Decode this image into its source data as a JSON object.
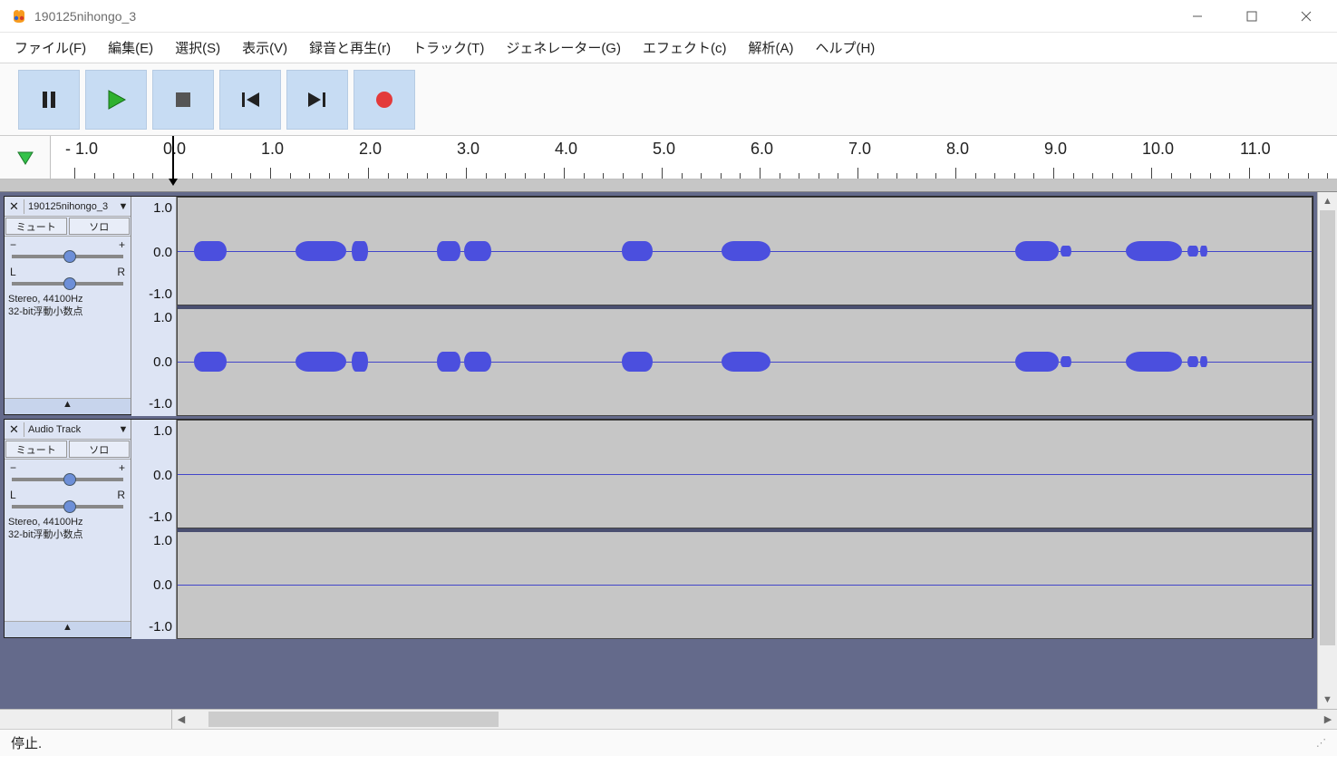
{
  "window": {
    "title": "190125nihongo_3"
  },
  "menu": {
    "items": [
      "ファイル(F)",
      "編集(E)",
      "選択(S)",
      "表示(V)",
      "録音と再生(r)",
      "トラック(T)",
      "ジェネレーター(G)",
      "エフェクト(c)",
      "解析(A)",
      "ヘルプ(H)"
    ]
  },
  "transport": {
    "pause": "pause",
    "play": "play",
    "stop": "stop",
    "skip_start": "skip-start",
    "skip_end": "skip-end",
    "record": "record"
  },
  "timeline": {
    "labels": [
      "- 1.0",
      "0.0",
      "1.0",
      "2.0",
      "3.0",
      "4.0",
      "5.0",
      "6.0",
      "7.0",
      "8.0",
      "9.0",
      "10.0",
      "11.0"
    ],
    "cursor_time": 0.0
  },
  "tracks": [
    {
      "name": "190125nihongo_3",
      "mute": "ミュート",
      "solo": "ソロ",
      "gain_min": "−",
      "gain_max": "+",
      "pan_left": "L",
      "pan_right": "R",
      "info1": "Stereo, 44100Hz",
      "info2": "32-bit浮動小数点",
      "vticks": [
        "1.0",
        "0.0",
        "-1.0",
        "1.0",
        "0.0",
        "-1.0"
      ],
      "has_audio": true
    },
    {
      "name": "Audio Track",
      "mute": "ミュート",
      "solo": "ソロ",
      "gain_min": "−",
      "gain_max": "+",
      "pan_left": "L",
      "pan_right": "R",
      "info1": "Stereo, 44100Hz",
      "info2": "32-bit浮動小数点",
      "vticks": [
        "1.0",
        "0.0",
        "-1.0",
        "1.0",
        "0.0",
        "-1.0"
      ],
      "has_audio": false
    }
  ],
  "status": {
    "text": "停止."
  },
  "colors": {
    "accent": "#4b4fde",
    "panel": "#dde4f4",
    "trackbg": "#c6c6c6"
  }
}
